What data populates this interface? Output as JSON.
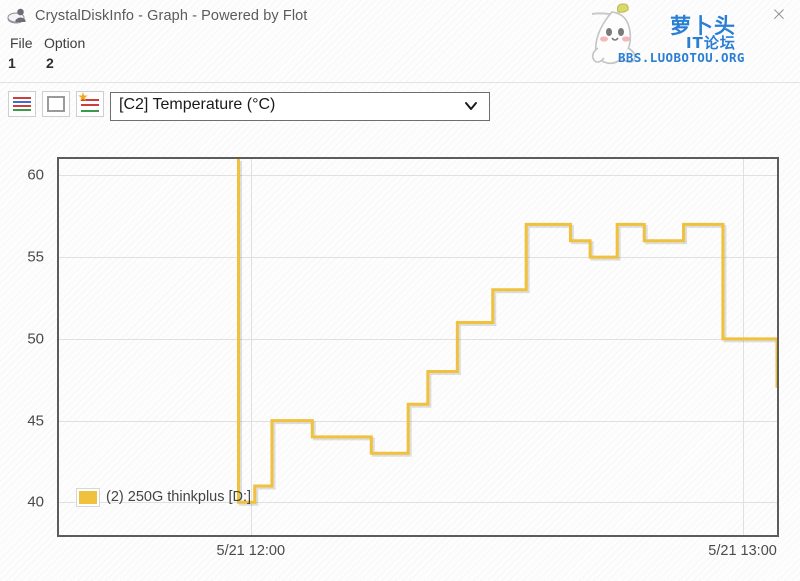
{
  "window": {
    "title": "CrystalDiskInfo - Graph - Powered by Flot",
    "title_icon": "disk-user-icon",
    "close_label": "×"
  },
  "watermark": {
    "mascot": "radish-mascot-icon",
    "line1": "萝卜头",
    "line2": "IT论坛",
    "url": "BBS.LUOBOTOU.ORG",
    "color": "#2a7fd4"
  },
  "menubar": {
    "items": [
      {
        "label": "File",
        "accesskey": "1"
      },
      {
        "label": "Option",
        "accesskey": "2"
      }
    ]
  },
  "toolbar": {
    "buttons": [
      {
        "name": "multi-line-graph-icon",
        "title": "All graphs"
      },
      {
        "name": "blank-graph-icon",
        "title": "Clear graph"
      },
      {
        "name": "alert-graph-icon",
        "title": "Alert graph"
      }
    ],
    "select": {
      "value": "[C2] Temperature (°C)",
      "arrow_icon": "chevron-down-icon"
    }
  },
  "chart_data": {
    "type": "line",
    "line_style": "step",
    "title": "",
    "xlabel": "",
    "ylabel": "",
    "ylim": [
      38.0,
      61.0
    ],
    "yticks": [
      40,
      45,
      50,
      55,
      60
    ],
    "ytick_labels": [
      "40",
      "45",
      "50",
      "55",
      "60"
    ],
    "xlim": [
      11.61,
      13.07
    ],
    "xticks": [
      12.0,
      13.0
    ],
    "xtick_labels": [
      "5/21 12:00",
      "5/21 13:00"
    ],
    "grid": true,
    "legend": {
      "position": "bottom-left",
      "entries": [
        {
          "label": "(2) 250G thinkplus [D:]",
          "color": "#efc13c"
        }
      ]
    },
    "series": [
      {
        "name": "(2) 250G thinkplus [D:]",
        "color": "#efc13c",
        "x": [
          11.975,
          11.975,
          11.992,
          12.008,
          12.038,
          12.043,
          12.062,
          12.125,
          12.23,
          12.245,
          12.295,
          12.32,
          12.342,
          12.36,
          12.382,
          12.42,
          12.44,
          12.492,
          12.53,
          12.56,
          12.6,
          12.65,
          12.69,
          12.745,
          12.8,
          12.852,
          12.88,
          12.92,
          12.96,
          13.07
        ],
        "y": [
          61.0,
          40,
          40,
          41,
          41,
          45,
          45,
          44,
          44,
          43,
          43,
          46,
          46,
          48,
          48,
          51,
          51,
          53,
          53,
          57,
          57,
          56,
          55,
          57,
          56,
          56,
          57,
          57,
          50,
          47
        ],
        "annotation": "Initial spike above 60 °C, settles to 40 °C, rises in steps to a 55-57 °C plateau, then drops to 50 and 47 °C"
      }
    ]
  }
}
